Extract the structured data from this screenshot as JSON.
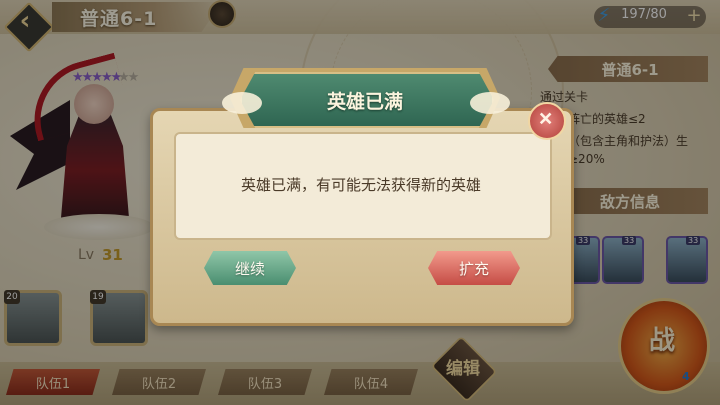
{
  "header": {
    "level_title": "普通6-1",
    "energy": "197/80",
    "energy_plus": "+"
  },
  "hero": {
    "lv_label": "Lv",
    "lv_value": "31",
    "team_slots": [
      {
        "badge": "20"
      },
      {
        "badge": "19"
      }
    ]
  },
  "right_panel": {
    "stage_title": "普通6-1",
    "conditions": [
      "通过关卡",
      "时阵亡的英雄≤2",
      "员（包含主角和护法）生",
      "值≥20%"
    ],
    "enemy_title": "敌方信息",
    "enemy_levels": [
      "33",
      "33",
      "33"
    ]
  },
  "bottom": {
    "teams": [
      "队伍1",
      "队伍2",
      "队伍3",
      "队伍4"
    ],
    "edit_label": "编辑",
    "battle_label": "战",
    "battle_cost": "4"
  },
  "dialog": {
    "title": "英雄已满",
    "message": "英雄已满，有可能无法获得新的英雄",
    "continue_label": "继续",
    "expand_label": "扩充",
    "close_label": "+"
  },
  "colors": {
    "banner_green": "#2f6652",
    "continue_green": "#4a8e70",
    "expand_red": "#c54c45",
    "lv_gold": "#c49b2d"
  }
}
